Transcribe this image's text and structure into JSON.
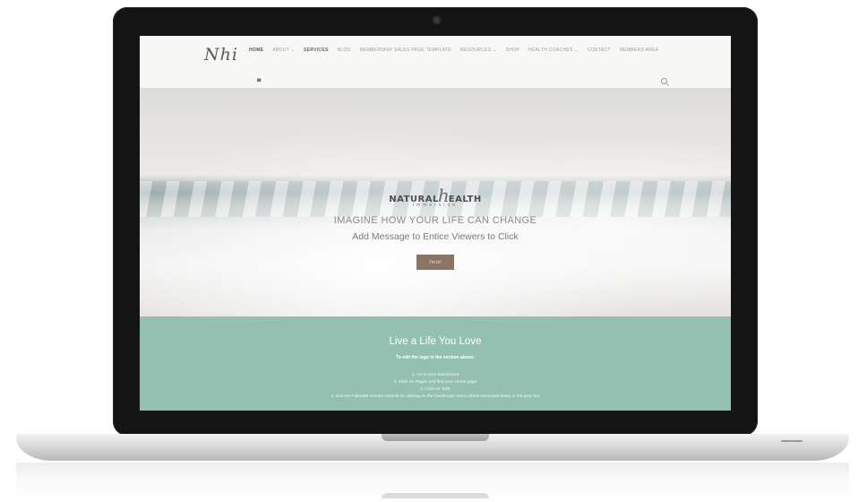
{
  "site": {
    "logo": "Nhi",
    "nav": [
      "HOME",
      "ABOUT ⌄",
      "SERVICES",
      "BLOG",
      "MEMBERSHIP SALES PAGE TEMPLATE",
      "RESOURCES ⌄",
      "SHOP",
      "HEALTH COACHES ⌄",
      "CONTACT",
      "MEMBERS AREA"
    ],
    "active_nav": "HOME"
  },
  "hero": {
    "brand_left": "NATURAL",
    "brand_h": "h",
    "brand_right": "EALTH",
    "brand_sub": "immersion",
    "heading": "IMAGINE HOW YOUR LIFE CAN CHANGE",
    "subheading": "Add Message to Entice Viewers to Click",
    "button": "I'm in!"
  },
  "section": {
    "title": "Live a Life You Love",
    "instructions_title": "To edit the logo in the section above:",
    "steps": [
      "1. Go to your Dashboard",
      "2. Click on Pages and find your Home page",
      "3. Click on 'Edit'",
      "4. Edit the Fullwidth Header module by clicking on the hamburger menu (three horizontal lines) in the grey bar"
    ]
  },
  "colors": {
    "teal": "#93c0b1",
    "button": "#8a7466"
  }
}
